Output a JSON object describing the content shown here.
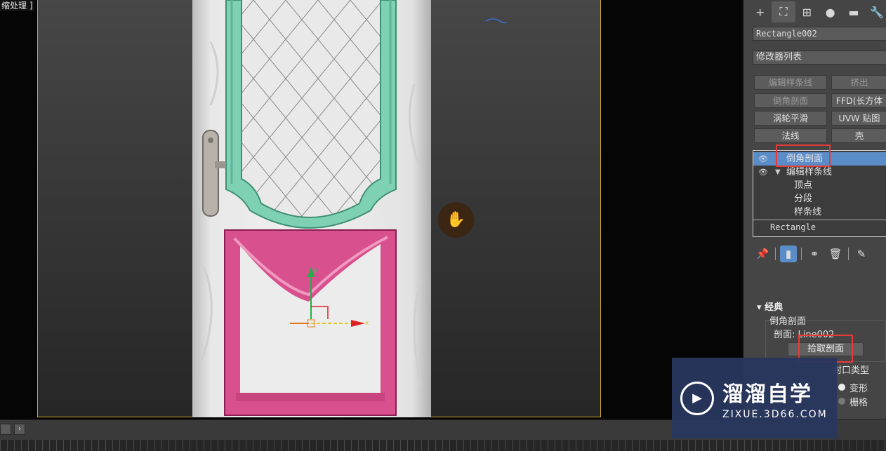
{
  "viewport": {
    "label": "缩处理 ]"
  },
  "command_panel": {
    "object_name": "Rectangle002",
    "modifier_list_label": "修改器列表",
    "modifier_buttons": [
      "编辑样条线",
      "挤出",
      "倒角剖面",
      "FFD(长方体",
      "涡轮平滑",
      "UVW 贴图",
      "法线",
      "壳"
    ],
    "stack": {
      "items": [
        {
          "label": "倒角剖面",
          "selected": true
        },
        {
          "label": "编辑样条线",
          "selected": false
        }
      ],
      "subobjects": [
        "顶点",
        "分段",
        "样条线"
      ],
      "base": "Rectangle"
    },
    "rollout": {
      "title": "经典",
      "group_label": "倒角剖面",
      "profile_label": "剖面: Line002",
      "pick_button": "拾取剖面",
      "cap_type_label": "封口类型",
      "options": [
        "变形",
        "栅格"
      ]
    }
  },
  "watermark": {
    "title": "溜溜自学",
    "url": "ZIXUE.3D66.COM"
  },
  "icons": [
    "create-icon",
    "modify-icon",
    "hierarchy-icon",
    "motion-icon",
    "display-icon",
    "utilities-icon",
    "pin-icon",
    "show-end-result-icon",
    "make-unique-icon",
    "remove-modifier-icon",
    "configure-icon",
    "pan-hand-icon",
    "play-icon"
  ],
  "colors": {
    "selection": "#5a8cc8",
    "highlight_box": "#e63a3a",
    "teal_molding": "#7fd1b4",
    "pink_molding": "#d8508e",
    "safe_frame": "#c8a82a"
  }
}
